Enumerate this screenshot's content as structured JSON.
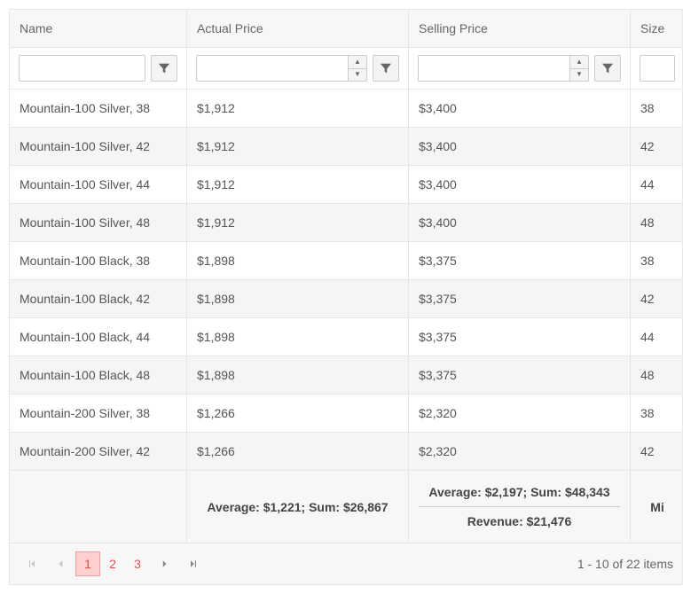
{
  "columns": {
    "name": "Name",
    "actual": "Actual Price",
    "selling": "Selling Price",
    "size": "Size"
  },
  "rows": [
    {
      "name": "Mountain-100 Silver, 38",
      "actual": "$1,912",
      "selling": "$3,400",
      "size": "38"
    },
    {
      "name": "Mountain-100 Silver, 42",
      "actual": "$1,912",
      "selling": "$3,400",
      "size": "42"
    },
    {
      "name": "Mountain-100 Silver, 44",
      "actual": "$1,912",
      "selling": "$3,400",
      "size": "44"
    },
    {
      "name": "Mountain-100 Silver, 48",
      "actual": "$1,912",
      "selling": "$3,400",
      "size": "48"
    },
    {
      "name": "Mountain-100 Black, 38",
      "actual": "$1,898",
      "selling": "$3,375",
      "size": "38"
    },
    {
      "name": "Mountain-100 Black, 42",
      "actual": "$1,898",
      "selling": "$3,375",
      "size": "42"
    },
    {
      "name": "Mountain-100 Black, 44",
      "actual": "$1,898",
      "selling": "$3,375",
      "size": "44"
    },
    {
      "name": "Mountain-100 Black, 48",
      "actual": "$1,898",
      "selling": "$3,375",
      "size": "48"
    },
    {
      "name": "Mountain-200 Silver, 38",
      "actual": "$1,266",
      "selling": "$2,320",
      "size": "38"
    },
    {
      "name": "Mountain-200 Silver, 42",
      "actual": "$1,266",
      "selling": "$2,320",
      "size": "42"
    }
  ],
  "footer": {
    "actual": "Average: $1,221; Sum: $26,867",
    "selling_line1": "Average: $2,197; Sum: $48,343",
    "selling_line2": "Revenue: $21,476",
    "size": "Mi"
  },
  "pager": {
    "pages": [
      "1",
      "2",
      "3"
    ],
    "active": "1",
    "info": "1 - 10 of 22 items"
  }
}
